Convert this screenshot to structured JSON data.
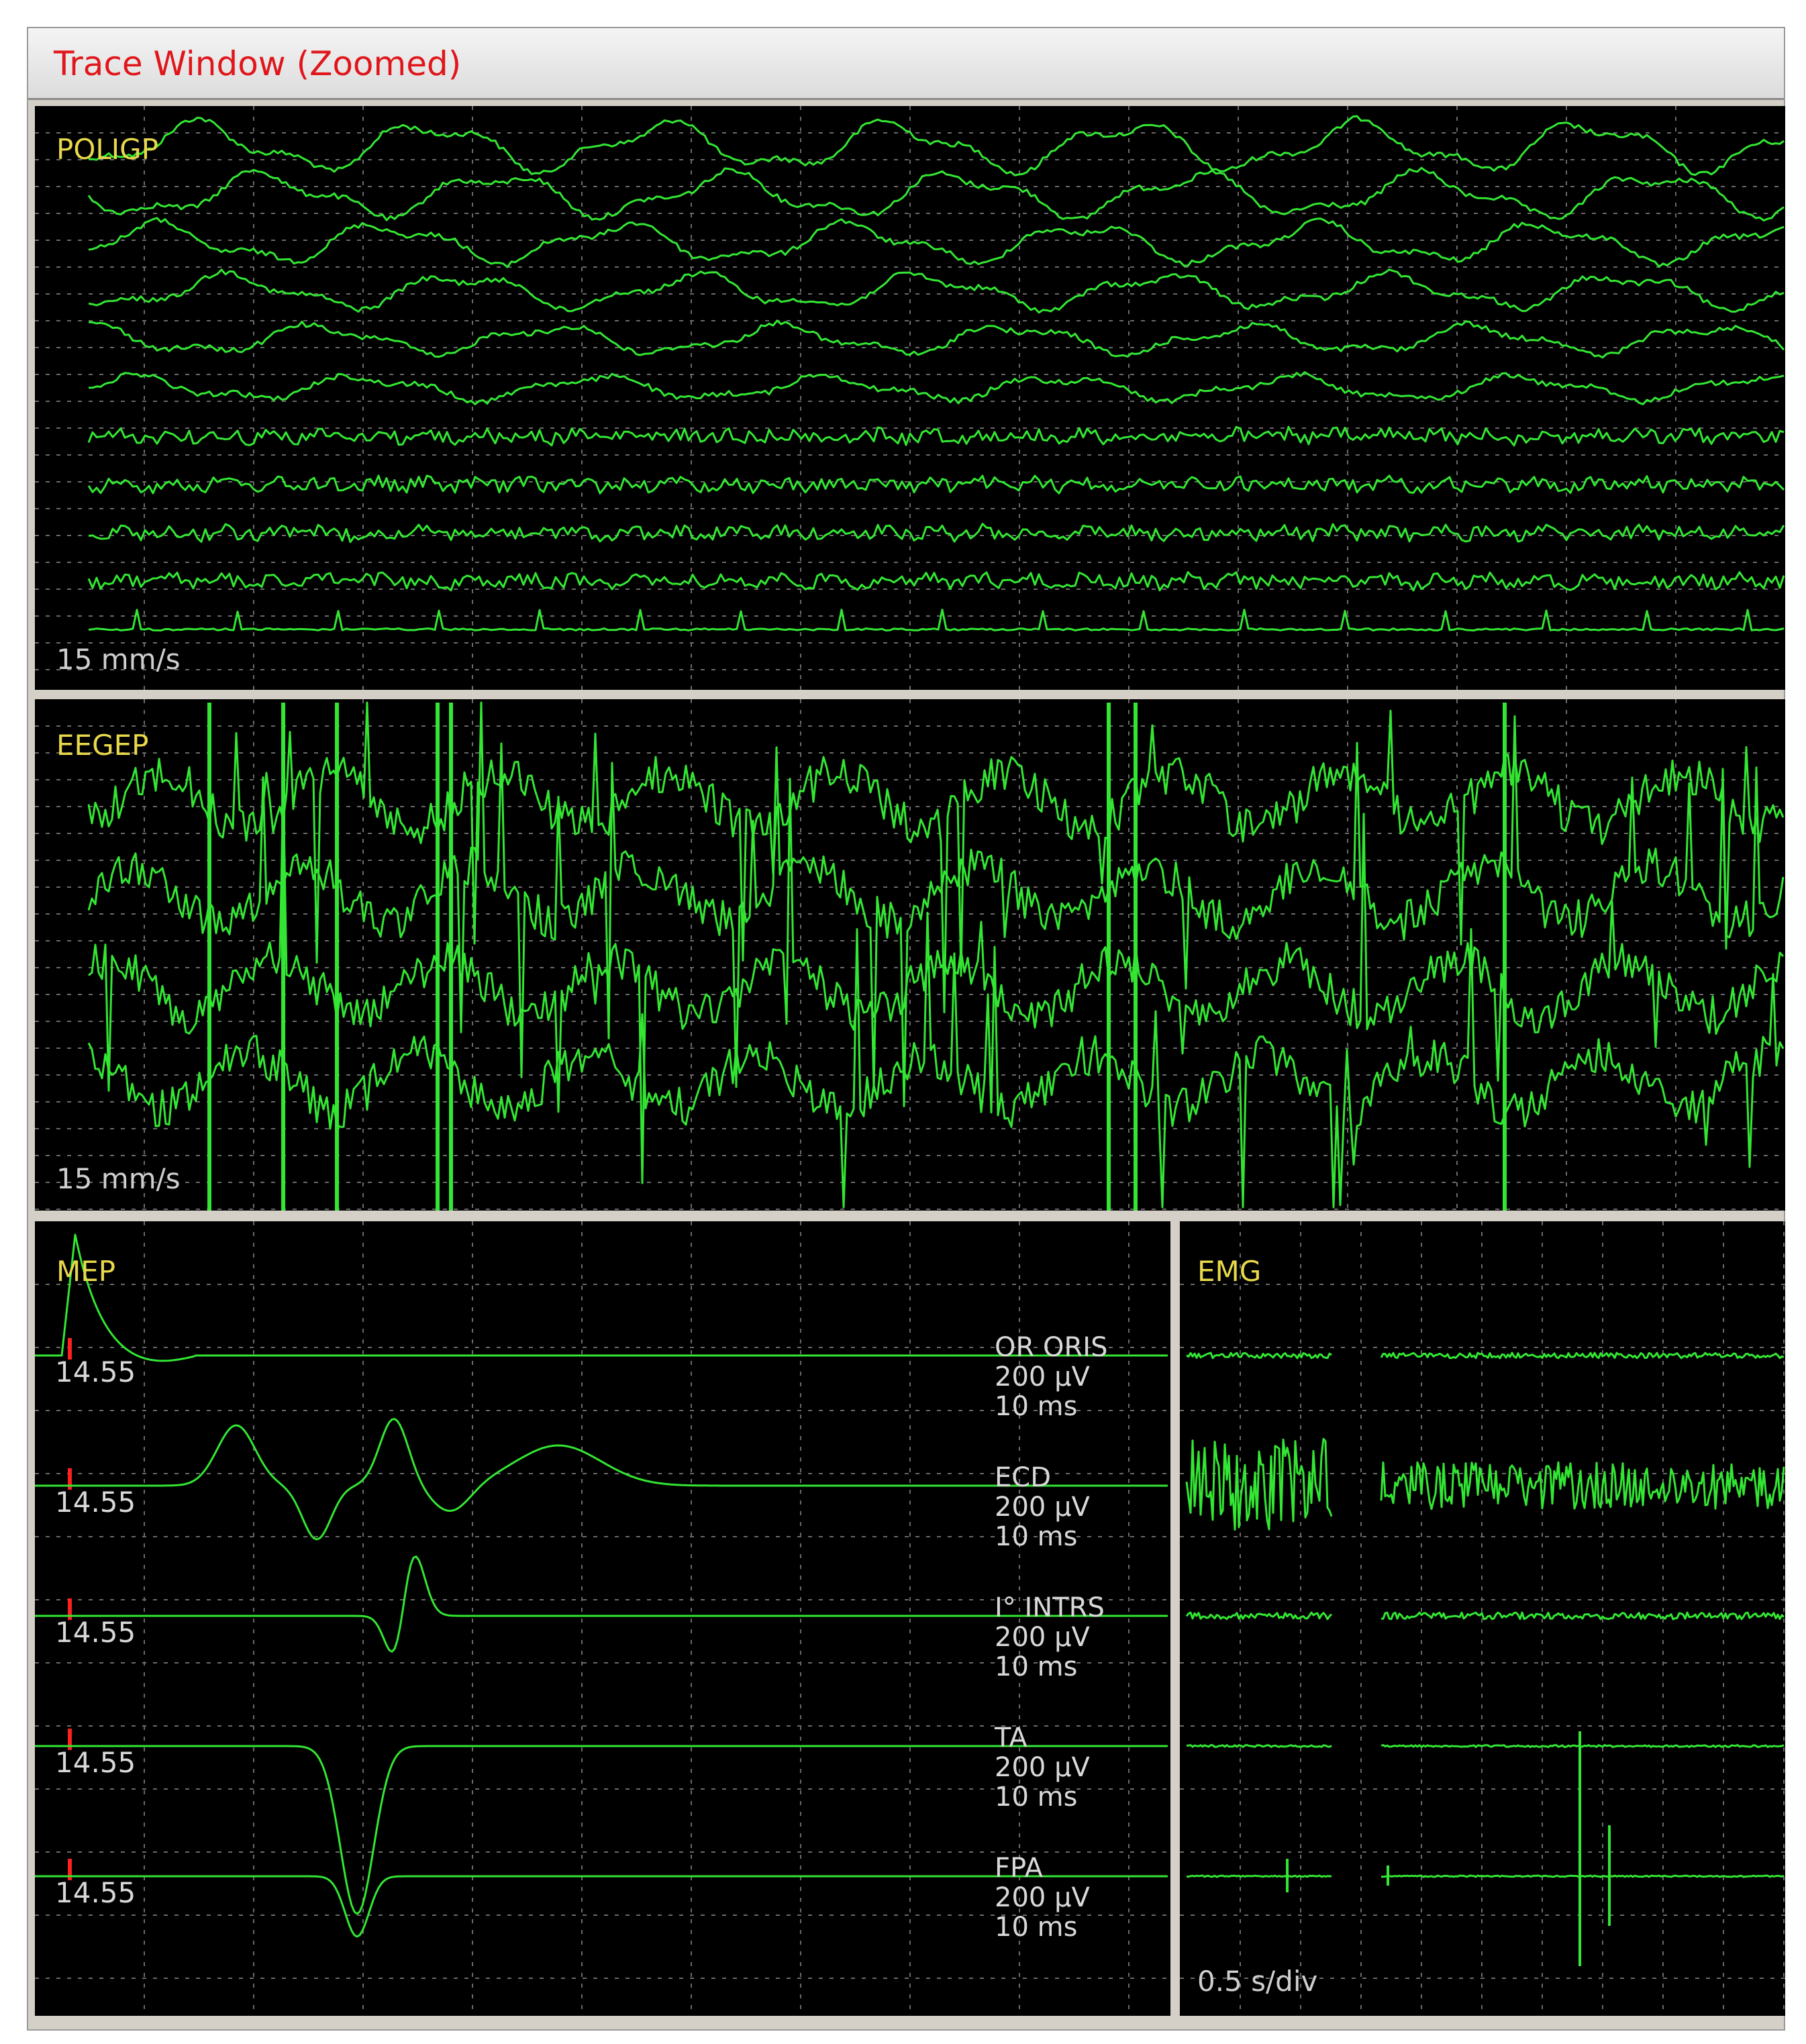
{
  "window": {
    "title": "Trace Window (Zoomed)"
  },
  "colors": {
    "trace": "#33e633",
    "grid": "#6a6a6a",
    "background": "#000000",
    "label": "#e8d84a",
    "title": "#e0161b",
    "marker": "#ff2020"
  },
  "poligp": {
    "label": "POLIGP",
    "speed": "15 mm/s",
    "channel_count": 11
  },
  "eegep": {
    "label": "EEGEP",
    "speed": "15 mm/s",
    "channel_count": 4
  },
  "mep": {
    "label": "MEP",
    "channels": [
      {
        "latency": "14.55",
        "name": "OR ORIS",
        "gain": "200 µV",
        "time": "10 ms"
      },
      {
        "latency": "14.55",
        "name": "ECD",
        "gain": "200 µV",
        "time": "10 ms"
      },
      {
        "latency": "14.55",
        "name": "I° INTRS",
        "gain": "200 µV",
        "time": "10 ms"
      },
      {
        "latency": "14.55",
        "name": "TA",
        "gain": "200 µV",
        "time": "10 ms"
      },
      {
        "latency": "14.55",
        "name": "FPA",
        "gain": "200 µV",
        "time": "10 ms"
      }
    ]
  },
  "emg": {
    "label": "EMG",
    "speed": "0.5 s/div",
    "channel_count": 5
  }
}
